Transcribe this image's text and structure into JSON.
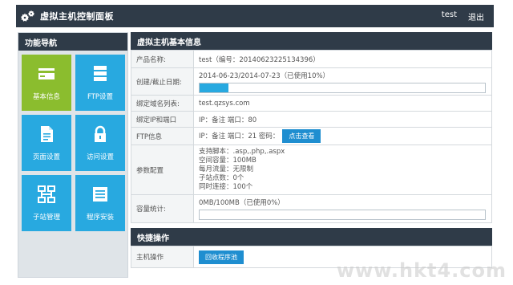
{
  "header": {
    "title": "虚拟主机控制面板",
    "user": "test",
    "logout": "退出",
    "logo_icon": "gears-icon"
  },
  "nav": {
    "title": "功能导航",
    "tiles": [
      {
        "label": "基本信息",
        "icon": "card-icon",
        "active": true
      },
      {
        "label": "FTP设置",
        "icon": "server-icon",
        "active": false
      },
      {
        "label": "页面设置",
        "icon": "document-icon",
        "active": false
      },
      {
        "label": "访问设置",
        "icon": "lock-icon",
        "active": false
      },
      {
        "label": "子站管理",
        "icon": "sitemap-icon",
        "active": false
      },
      {
        "label": "程序安装",
        "icon": "installer-icon",
        "active": false
      }
    ]
  },
  "info": {
    "title": "虚拟主机基本信息",
    "product_label": "产品名称:",
    "product_value": "test（编号：20140623225134396）",
    "date_label": "创建/截止日期:",
    "date_value": "2014-06-23/2014-07-23（已使用10%）",
    "date_progress": 10,
    "domain_label": "绑定域名列表:",
    "domain_value": "test.qzsys.com",
    "ip_label": "绑定IP和端口",
    "ip_value": "IP：备注 端口：80",
    "ftp_label": "FTP信息",
    "ftp_value": "IP：备注 端口：21 密码：",
    "ftp_button": "点击查看",
    "params_label": "参数配置",
    "params_lines": [
      "支持脚本：.asp,.php,.aspx",
      "空间容量：100MB",
      "每月流量：无限制",
      "子站点数：0个",
      "同时连接：100个"
    ],
    "capacity_label": "容量统计:",
    "capacity_value": "0MB/100MB（已使用0%）",
    "capacity_progress": 0
  },
  "quick": {
    "title": "快捷操作",
    "host_label": "主机操作",
    "recycle_button": "回收程序池"
  },
  "watermark": "www.hkt4.com",
  "colors": {
    "header_bg": "#2f3b48",
    "tile_blue": "#28a9e0",
    "tile_active": "#8bbd2e",
    "button_blue": "#1f8ed0"
  }
}
